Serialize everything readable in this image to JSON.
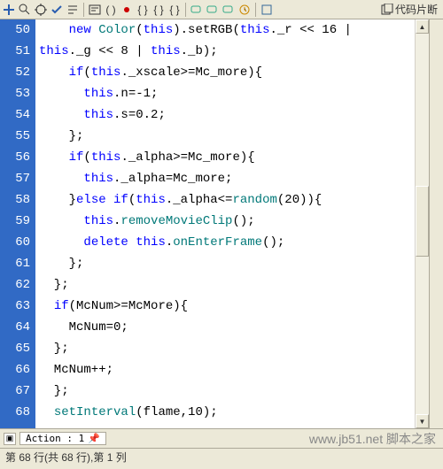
{
  "toolbar": {
    "snippet_label": "代码片断"
  },
  "gutter": {
    "start": 50,
    "end": 68
  },
  "code_lines": [
    {
      "n": 50,
      "segs": [
        [
          "    ",
          "k-dark"
        ],
        [
          "new ",
          "k-blue"
        ],
        [
          "Color",
          "k-teal"
        ],
        [
          "(",
          "k-dark"
        ],
        [
          "this",
          "k-blue"
        ],
        [
          ").setRGB(",
          "k-dark"
        ],
        [
          "this",
          "k-blue"
        ],
        [
          "._r << 16 | ",
          "k-dark"
        ]
      ]
    },
    {
      "n": "",
      "segs": [
        [
          "this",
          "k-blue"
        ],
        [
          "._g << 8 | ",
          "k-dark"
        ],
        [
          "this",
          "k-blue"
        ],
        [
          "._b);",
          "k-dark"
        ]
      ]
    },
    {
      "n": 51,
      "segs": [
        [
          "    ",
          "k-dark"
        ],
        [
          "if",
          "k-blue"
        ],
        [
          "(",
          "k-dark"
        ],
        [
          "this",
          "k-blue"
        ],
        [
          "._xscale>=Mc_more){",
          "k-dark"
        ]
      ]
    },
    {
      "n": 52,
      "segs": [
        [
          "      ",
          "k-dark"
        ],
        [
          "this",
          "k-blue"
        ],
        [
          ".n=-1;",
          "k-dark"
        ]
      ]
    },
    {
      "n": 53,
      "segs": [
        [
          "      ",
          "k-dark"
        ],
        [
          "this",
          "k-blue"
        ],
        [
          ".s=0.2;",
          "k-dark"
        ]
      ]
    },
    {
      "n": 54,
      "segs": [
        [
          "    };",
          "k-dark"
        ]
      ]
    },
    {
      "n": 55,
      "segs": [
        [
          "    ",
          "k-dark"
        ],
        [
          "if",
          "k-blue"
        ],
        [
          "(",
          "k-dark"
        ],
        [
          "this",
          "k-blue"
        ],
        [
          "._alpha>=Mc_more){",
          "k-dark"
        ]
      ]
    },
    {
      "n": 56,
      "segs": [
        [
          "      ",
          "k-dark"
        ],
        [
          "this",
          "k-blue"
        ],
        [
          "._alpha=Mc_more;",
          "k-dark"
        ]
      ]
    },
    {
      "n": 57,
      "segs": [
        [
          "    }",
          "k-dark"
        ],
        [
          "else if",
          "k-blue"
        ],
        [
          "(",
          "k-dark"
        ],
        [
          "this",
          "k-blue"
        ],
        [
          "._alpha<=",
          "k-dark"
        ],
        [
          "random",
          "k-teal"
        ],
        [
          "(20)){",
          "k-dark"
        ]
      ]
    },
    {
      "n": 58,
      "segs": [
        [
          "      ",
          "k-dark"
        ],
        [
          "this",
          "k-blue"
        ],
        [
          ".",
          "k-dark"
        ],
        [
          "removeMovieClip",
          "k-teal"
        ],
        [
          "();",
          "k-dark"
        ]
      ]
    },
    {
      "n": 59,
      "segs": [
        [
          "      ",
          "k-dark"
        ],
        [
          "delete ",
          "k-blue"
        ],
        [
          "this",
          "k-blue"
        ],
        [
          ".",
          "k-dark"
        ],
        [
          "onEnterFrame",
          "k-teal"
        ],
        [
          "();",
          "k-dark"
        ]
      ]
    },
    {
      "n": 60,
      "segs": [
        [
          "    };",
          "k-dark"
        ]
      ]
    },
    {
      "n": 61,
      "segs": [
        [
          "  };",
          "k-dark"
        ]
      ]
    },
    {
      "n": 62,
      "segs": [
        [
          "  ",
          "k-dark"
        ],
        [
          "if",
          "k-blue"
        ],
        [
          "(McNum>=McMore){",
          "k-dark"
        ]
      ]
    },
    {
      "n": 63,
      "segs": [
        [
          "    McNum=0;",
          "k-dark"
        ]
      ]
    },
    {
      "n": 64,
      "segs": [
        [
          "  };",
          "k-dark"
        ]
      ]
    },
    {
      "n": 65,
      "segs": [
        [
          "  McNum++;",
          "k-dark"
        ]
      ]
    },
    {
      "n": 66,
      "segs": [
        [
          "  };",
          "k-dark"
        ]
      ]
    },
    {
      "n": 67,
      "segs": [
        [
          "  ",
          "k-dark"
        ],
        [
          "setInterval",
          "k-teal"
        ],
        [
          "(flame,10);",
          "k-dark"
        ]
      ]
    },
    {
      "n": 68,
      "segs": [
        [
          "",
          "k-dark"
        ]
      ]
    }
  ],
  "tabs": {
    "action_label": "Action : 1",
    "pin": "📌"
  },
  "status": {
    "text": "第 68 行(共 68 行),第 1 列"
  },
  "watermark": "www.jb51.net 脚本之家"
}
